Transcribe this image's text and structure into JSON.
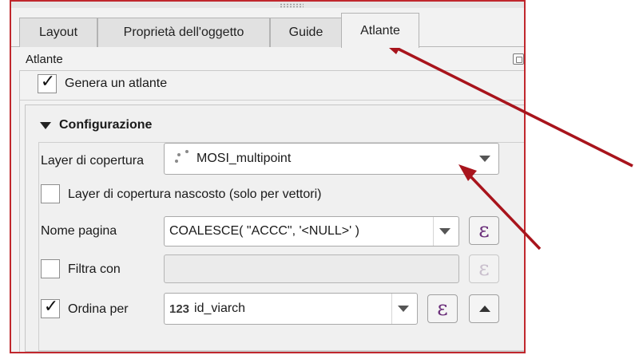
{
  "tabs": [
    {
      "label": "Layout"
    },
    {
      "label": "Proprietà dell'oggetto"
    },
    {
      "label": "Guide"
    },
    {
      "label": "Atlante"
    }
  ],
  "panel": {
    "title": "Atlante"
  },
  "generate_atlas": {
    "label": "Genera un atlante",
    "checked": true
  },
  "config": {
    "title": "Configurazione",
    "coverage_layer": {
      "label": "Layer di copertura",
      "value": "MOSI_multipoint",
      "icon": "multipoint-layer-icon"
    },
    "hidden_coverage": {
      "label": "Layer di copertura nascosto (solo per vettori)",
      "checked": false
    },
    "page_name": {
      "label": "Nome pagina",
      "value": "COALESCE( \"ACCC\", '<NULL>' )"
    },
    "filter": {
      "label": "Filtra con",
      "checked": false,
      "value": ""
    },
    "sort": {
      "label": "Ordina per",
      "checked": true,
      "value": "id_viarch",
      "type_prefix": "123"
    }
  },
  "icons": {
    "expression": "ε"
  },
  "colors": {
    "annotation_arrow": "#a8141c",
    "frame_border": "#c0272d",
    "expression_icon": "#6b2f7a"
  }
}
